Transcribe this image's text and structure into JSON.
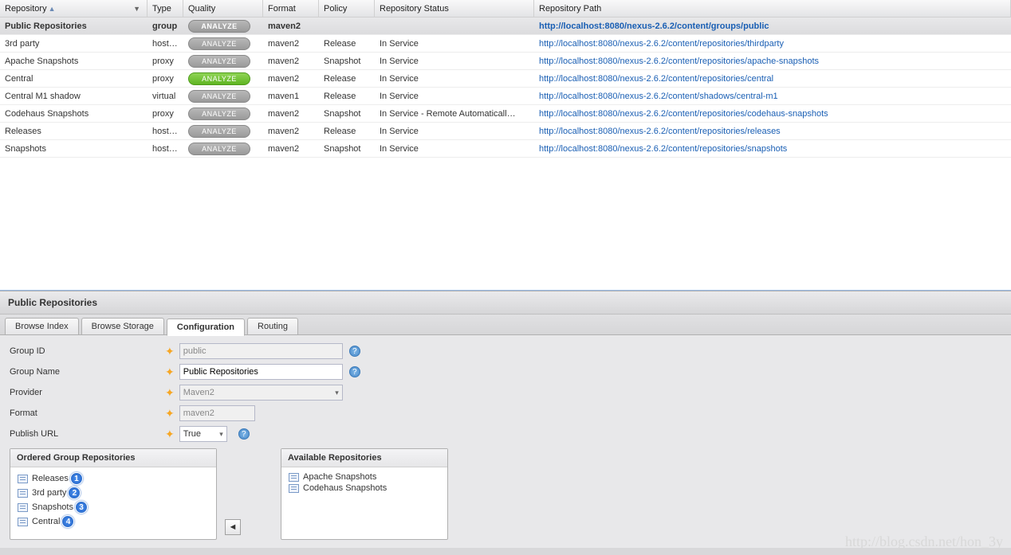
{
  "columns": {
    "repository": "Repository",
    "type": "Type",
    "quality": "Quality",
    "format": "Format",
    "policy": "Policy",
    "status": "Repository Status",
    "path": "Repository Path"
  },
  "analyze_label": "ANALYZE",
  "rows": [
    {
      "repo": "Public Repositories",
      "type": "group",
      "format": "maven2",
      "policy": "",
      "status": "",
      "path": "http://localhost:8080/nexus-2.6.2/content/groups/public",
      "selected": true,
      "green": false
    },
    {
      "repo": "3rd party",
      "type": "hosted",
      "format": "maven2",
      "policy": "Release",
      "status": "In Service",
      "path": "http://localhost:8080/nexus-2.6.2/content/repositories/thirdparty",
      "green": false
    },
    {
      "repo": "Apache Snapshots",
      "type": "proxy",
      "format": "maven2",
      "policy": "Snapshot",
      "status": "In Service",
      "path": "http://localhost:8080/nexus-2.6.2/content/repositories/apache-snapshots",
      "green": false
    },
    {
      "repo": "Central",
      "type": "proxy",
      "format": "maven2",
      "policy": "Release",
      "status": "In Service",
      "path": "http://localhost:8080/nexus-2.6.2/content/repositories/central",
      "green": true
    },
    {
      "repo": "Central M1 shadow",
      "type": "virtual",
      "format": "maven1",
      "policy": "Release",
      "status": "In Service",
      "path": "http://localhost:8080/nexus-2.6.2/content/shadows/central-m1",
      "green": false
    },
    {
      "repo": "Codehaus Snapshots",
      "type": "proxy",
      "format": "maven2",
      "policy": "Snapshot",
      "status": "In Service - Remote Automaticall…",
      "path": "http://localhost:8080/nexus-2.6.2/content/repositories/codehaus-snapshots",
      "green": false
    },
    {
      "repo": "Releases",
      "type": "hosted",
      "format": "maven2",
      "policy": "Release",
      "status": "In Service",
      "path": "http://localhost:8080/nexus-2.6.2/content/repositories/releases",
      "green": false
    },
    {
      "repo": "Snapshots",
      "type": "hosted",
      "format": "maven2",
      "policy": "Snapshot",
      "status": "In Service",
      "path": "http://localhost:8080/nexus-2.6.2/content/repositories/snapshots",
      "green": false
    }
  ],
  "detail": {
    "title": "Public Repositories",
    "tabs": [
      "Browse Index",
      "Browse Storage",
      "Configuration",
      "Routing"
    ],
    "active_tab": 2,
    "form": {
      "group_id": {
        "label": "Group ID",
        "value": "public"
      },
      "group_name": {
        "label": "Group Name",
        "value": "Public Repositories"
      },
      "provider": {
        "label": "Provider",
        "value": "Maven2"
      },
      "format": {
        "label": "Format",
        "value": "maven2"
      },
      "publish_url": {
        "label": "Publish URL",
        "value": "True"
      }
    },
    "ordered": {
      "legend": "Ordered Group Repositories",
      "items": [
        "Releases",
        "3rd party",
        "Snapshots",
        "Central"
      ]
    },
    "available": {
      "legend": "Available Repositories",
      "items": [
        "Apache Snapshots",
        "Codehaus Snapshots"
      ]
    }
  },
  "watermark": "http://blog.csdn.net/hon_3y"
}
